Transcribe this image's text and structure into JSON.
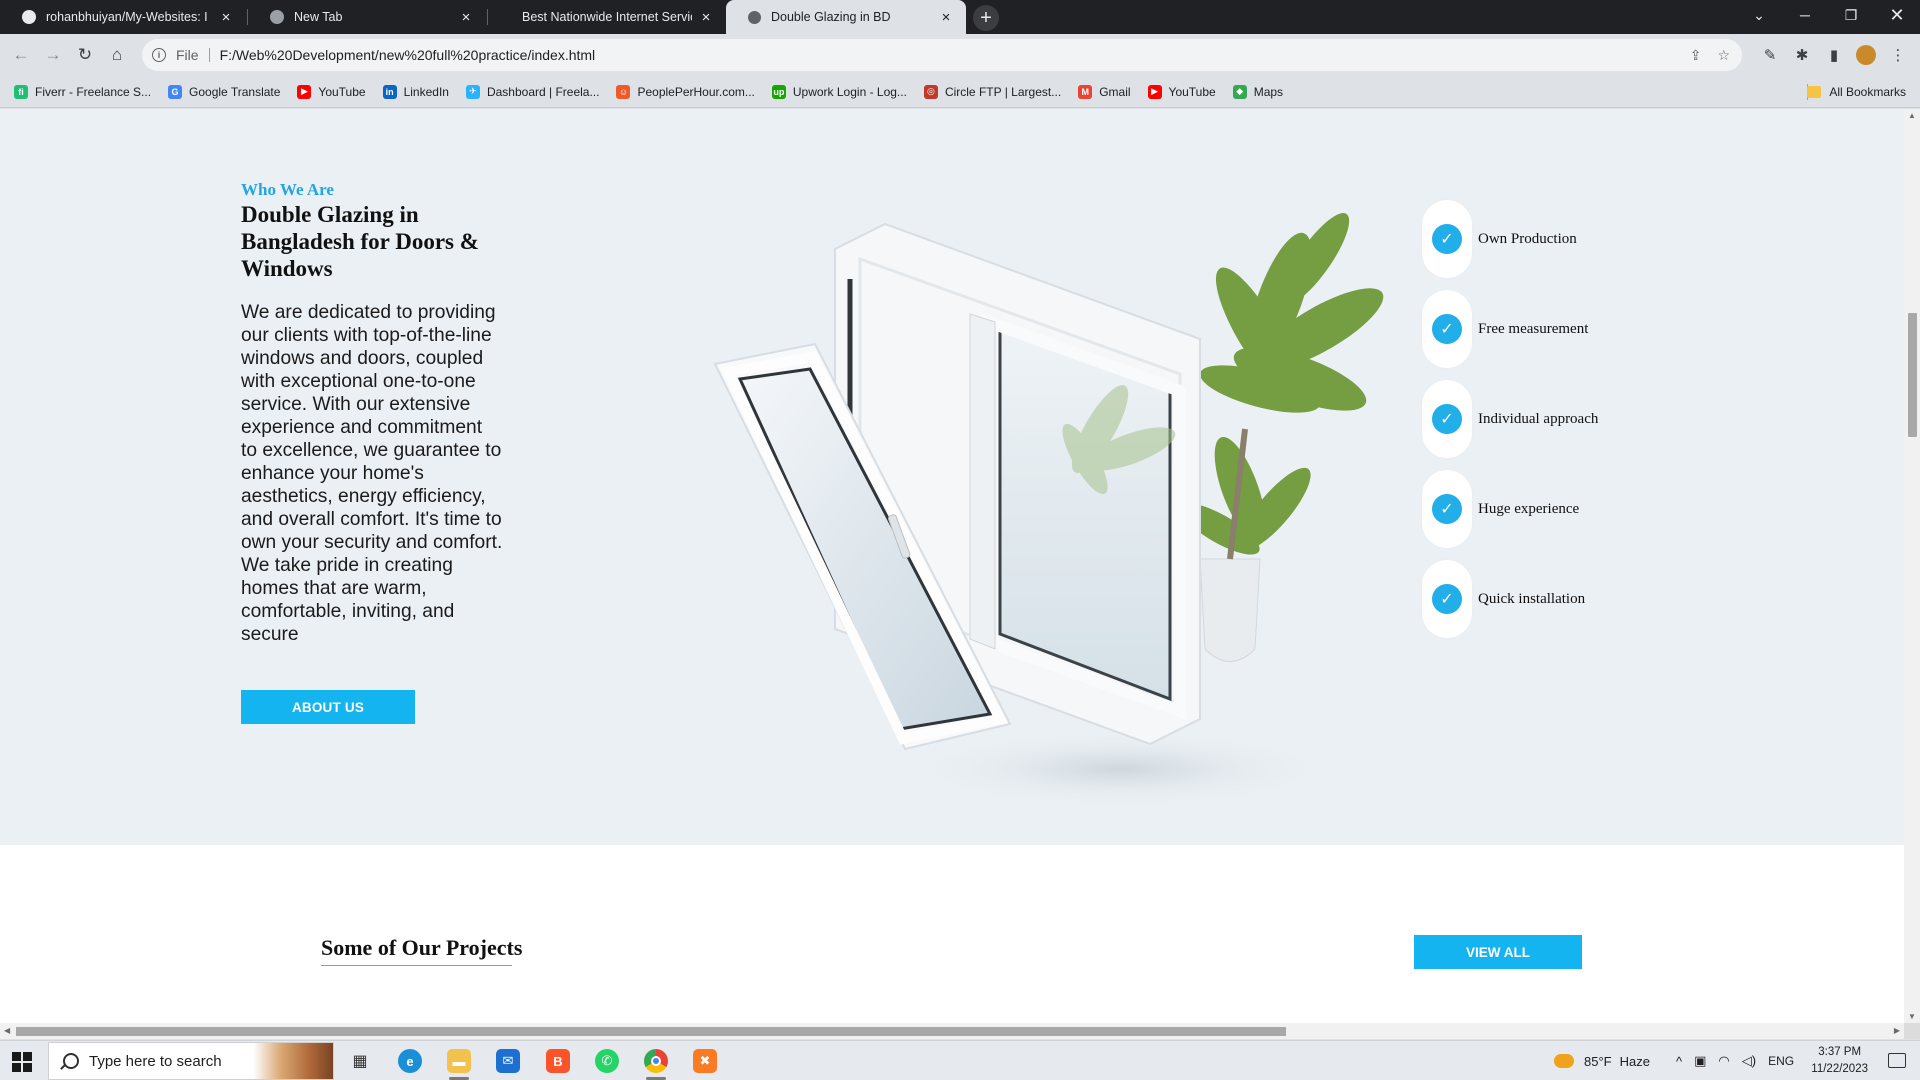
{
  "browser": {
    "tabs": [
      {
        "title": "rohanbhuiyan/My-Websites: I ha",
        "icon": "github-icon",
        "active": false
      },
      {
        "title": "New Tab",
        "icon": "chrome-icon",
        "active": false
      },
      {
        "title": "Best Nationwide Internet Servic",
        "icon": "globe-icon",
        "active": false
      },
      {
        "title": "Double Glazing in BD",
        "icon": "globe-icon",
        "active": true
      }
    ],
    "address": {
      "scheme_label": "File",
      "url": "F:/Web%20Development/new%20full%20practice/index.html"
    },
    "bookmarks": [
      {
        "label": "Fiverr - Freelance S...",
        "color": "#1dbf73",
        "glyph": "fi"
      },
      {
        "label": "Google Translate",
        "color": "#4285f4",
        "glyph": "G"
      },
      {
        "label": "YouTube",
        "color": "#ff0000",
        "glyph": "▶"
      },
      {
        "label": "LinkedIn",
        "color": "#0a66c2",
        "glyph": "in"
      },
      {
        "label": "Dashboard | Freela...",
        "color": "#29b2fe",
        "glyph": "✈"
      },
      {
        "label": "PeoplePerHour.com...",
        "color": "#f05a28",
        "glyph": "☺"
      },
      {
        "label": "Upwork Login - Log...",
        "color": "#14a800",
        "glyph": "up"
      },
      {
        "label": "Circle FTP | Largest...",
        "color": "#c0392b",
        "glyph": "◎"
      },
      {
        "label": "Gmail",
        "color": "#ea4335",
        "glyph": "M"
      },
      {
        "label": "YouTube",
        "color": "#ff0000",
        "glyph": "▶"
      },
      {
        "label": "Maps",
        "color": "#34a853",
        "glyph": "◆"
      }
    ],
    "all_bookmarks": "All Bookmarks"
  },
  "page": {
    "eyebrow": "Who We Are",
    "heading": "Double Glazing in Bangladesh for Doors & Windows",
    "paragraph": "We are dedicated to providing our clients with top-of-the-line windows and doors, coupled with exceptional one-to-one service. With our extensive experience and commitment to excellence, we guarantee to enhance your home's aesthetics, energy efficiency, and overall comfort. It's time to own your security and comfort. We take pride in creating homes that are warm, comfortable, inviting, and secure",
    "about_button": "ABOUT US",
    "features": [
      "Own Production",
      "Free measurement",
      "Individual approach",
      "Huge experience",
      "Quick installation"
    ],
    "projects_title": "Some of Our Projects",
    "view_all_button": "VIEW ALL",
    "accent_color": "#13b4ef"
  },
  "taskbar": {
    "search_placeholder": "Type here to search",
    "apps": [
      "task-view-icon",
      "edge-icon",
      "file-explorer-icon",
      "mail-icon",
      "brave-icon",
      "whatsapp-icon",
      "chrome-icon",
      "xampp-icon"
    ],
    "weather": {
      "temp": "85°F",
      "condition": "Haze"
    },
    "language": "ENG",
    "time": "3:37 PM",
    "date": "11/22/2023"
  }
}
